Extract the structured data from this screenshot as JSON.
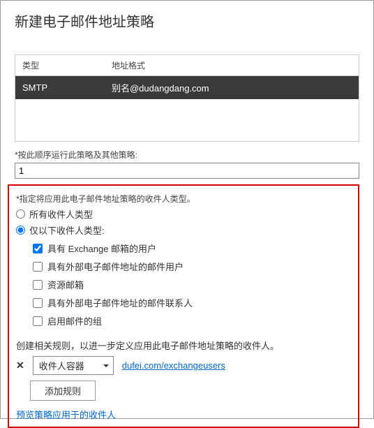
{
  "title": "新建电子邮件地址策略",
  "table": {
    "headers": {
      "type": "类型",
      "format": "地址格式"
    },
    "row": {
      "type": "SMTP",
      "format": "别名@dudangdang.com"
    }
  },
  "orderLabel": "*按此顺序运行此策略及其他策略:",
  "orderValue": "1",
  "recipientTypeLabel": "*指定将应用此电子邮件地址策略的收件人类型。",
  "radios": {
    "all": "所有收件人类型",
    "only": "仅以下收件人类型:"
  },
  "checkboxes": {
    "exchange": "具有 Exchange 邮箱的用户",
    "external": "具有外部电子邮件地址的邮件用户",
    "resource": "资源邮箱",
    "contact": "具有外部电子邮件地址的邮件联系人",
    "group": "启用邮件的组"
  },
  "ruleText": "创建相关规则，以进一步定义应用此电子邮件地址策略的收件人。",
  "ruleDropdown": "收件人容器",
  "ruleLink": "dufei.com/exchangeusers",
  "addRuleBtn": "添加规则",
  "previewLink": "预览策略应用于的收件人"
}
